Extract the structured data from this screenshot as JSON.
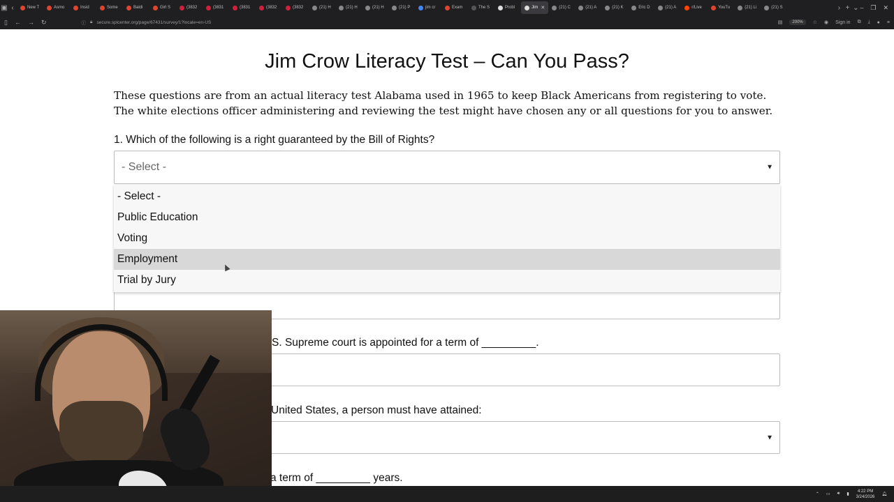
{
  "browser": {
    "tabs": [
      {
        "label": "New T",
        "color": "#e0452d"
      },
      {
        "label": "Asmo",
        "color": "#e0452d"
      },
      {
        "label": "Insid",
        "color": "#e0452d"
      },
      {
        "label": "Some",
        "color": "#e0452d"
      },
      {
        "label": "Baldi",
        "color": "#e0452d"
      },
      {
        "label": "Girl S",
        "color": "#e0452d"
      },
      {
        "label": "(3832",
        "color": "#d0203a"
      },
      {
        "label": "(3831",
        "color": "#d0203a"
      },
      {
        "label": "(3831",
        "color": "#d0203a"
      },
      {
        "label": "(3832",
        "color": "#d0203a"
      },
      {
        "label": "(3832",
        "color": "#d0203a"
      },
      {
        "label": "(21) H",
        "color": "#888888"
      },
      {
        "label": "(21) H",
        "color": "#888888"
      },
      {
        "label": "(21) H",
        "color": "#888888"
      },
      {
        "label": "(21) P",
        "color": "#888888"
      },
      {
        "label": "jim cr",
        "color": "#4285f4"
      },
      {
        "label": "Exam",
        "color": "#e0452d"
      },
      {
        "label": "The S",
        "color": "#555555"
      },
      {
        "label": "Probl",
        "color": "#dddddd"
      },
      {
        "label": "Jim",
        "color": "#dddddd",
        "active": true
      },
      {
        "label": "(21) C",
        "color": "#888888"
      },
      {
        "label": "(21) A",
        "color": "#888888"
      },
      {
        "label": "(21) K",
        "color": "#888888"
      },
      {
        "label": "Eric D",
        "color": "#888888"
      },
      {
        "label": "(21) A",
        "color": "#888888"
      },
      {
        "label": "r/Live",
        "color": "#ff4500"
      },
      {
        "label": "YouTu",
        "color": "#e0452d"
      },
      {
        "label": "(21) Li",
        "color": "#888888"
      },
      {
        "label": "(21) S",
        "color": "#888888"
      }
    ],
    "url": "secure.splcenter.org/page/67431/survey/1?locale=en-US",
    "zoom": "200%",
    "sign_in": "Sign in"
  },
  "page": {
    "title": "Jim Crow Literacy Test – Can You Pass?",
    "intro": "These questions are from an actual literacy test Alabama used in 1965 to keep Black Americans from registering to vote. The white elections officer administering and reviewing the test might have chosen any or all questions for you to answer.",
    "q1": {
      "label": "1. Which of the following is a right guaranteed by the Bill of Rights?",
      "selected": "- Select -",
      "options": [
        "- Select -",
        "Public Education",
        "Voting",
        "Employment",
        "Trial by Jury"
      ],
      "hovered_index": 3
    },
    "q3_partial": "S. Supreme court is appointed for a term of _________.",
    "q4_partial": "United States, a person must have attained:",
    "q5_partial": "a term of _________ years."
  },
  "taskbar": {
    "time": "4:22 PM",
    "date": "3/24/2026"
  }
}
